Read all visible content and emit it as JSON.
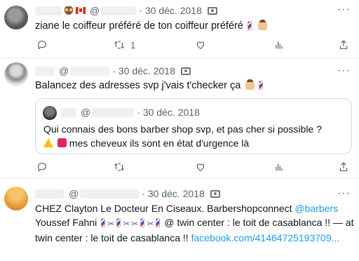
{
  "tweets": [
    {
      "date": "30 déc. 2018",
      "at": "@",
      "text": "ziane le coiffeur préféré de ton coiffeur préféré",
      "actions": {
        "replies": "",
        "retweets": "1",
        "likes": "",
        "views": ""
      }
    },
    {
      "date": "30 déc. 2018",
      "at": "@",
      "text": "Balancez des adresses svp j'vais t'checker ça",
      "quote": {
        "date": "30 déc. 2018",
        "at": "@",
        "line1": "Qui connais des bons barber shop svp, et pas cher si possible ?",
        "line2": "mes cheveux ils sont en état d'urgence là"
      },
      "actions": {
        "replies": "",
        "retweets": "",
        "likes": "",
        "views": ""
      }
    },
    {
      "date": "30 déc. 2018",
      "at": "@",
      "line1_text": "CHEZ Clayton Le Docteur En Ciseaux. Barbershopconnect ",
      "line1_link": "@barbers",
      "line2_start": "Youssef Fahni ",
      "line2_end": " @ twin center : le toit de casablanca !! — at",
      "line3_text": "twin center : le toit de casablanca !! ",
      "line3_link": "facebook.com/41464725193709..."
    }
  ],
  "icons": {
    "more": "more-horizontal-icon",
    "camera": "camera-icon",
    "reply": "reply-icon",
    "retweet": "retweet-icon",
    "like": "heart-icon",
    "views": "bar-chart-icon",
    "share": "share-icon"
  },
  "colors": {
    "link": "#1d9bf0",
    "text": "#0f1419",
    "muted": "#536471",
    "border": "#e7e9ea"
  }
}
